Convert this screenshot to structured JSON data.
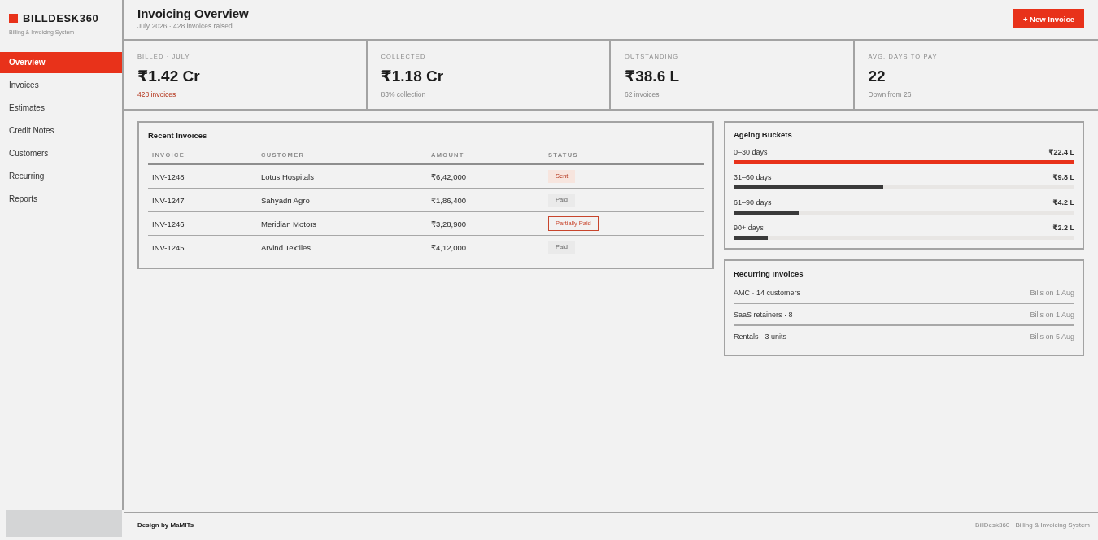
{
  "sidebar": {
    "brand": "BILLDESK360",
    "tagline": "Billing & Invoicing System",
    "items": [
      {
        "label": "Overview",
        "selected": true
      },
      {
        "label": "Invoices",
        "selected": false
      },
      {
        "label": "Estimates",
        "selected": false
      },
      {
        "label": "Credit Notes",
        "selected": false
      },
      {
        "label": "Customers",
        "selected": false
      },
      {
        "label": "Recurring",
        "selected": false
      },
      {
        "label": "Reports",
        "selected": false
      }
    ]
  },
  "header": {
    "title": "Invoicing Overview",
    "subtitle": "July 2026 · 428 invoices raised",
    "button": "+ New Invoice"
  },
  "kpis": [
    {
      "label": "BILLED · JULY",
      "value": "₹1.42 Cr",
      "note": "428 invoices",
      "highlighted": true
    },
    {
      "label": "COLLECTED",
      "value": "₹1.18 Cr",
      "note": "83% collection",
      "highlighted": false
    },
    {
      "label": "OUTSTANDING",
      "value": "₹38.6 L",
      "note": "62 invoices",
      "highlighted": false
    },
    {
      "label": "AVG. DAYS TO PAY",
      "value": "22",
      "note": "Down from 26",
      "highlighted": false
    }
  ],
  "recent_invoices": {
    "title": "Recent Invoices",
    "columns": [
      "INVOICE",
      "CUSTOMER",
      "AMOUNT",
      "STATUS"
    ],
    "rows": [
      {
        "invoice": "INV-1248",
        "customer": "Lotus Hospitals",
        "amount": "₹6,42,000",
        "status": {
          "label": "Sent",
          "kind": "sent"
        }
      },
      {
        "invoice": "INV-1247",
        "customer": "Sahyadri Agro",
        "amount": "₹1,86,400",
        "status": {
          "label": "Paid",
          "kind": "paid"
        }
      },
      {
        "invoice": "INV-1246",
        "customer": "Meridian Motors",
        "amount": "₹3,28,900",
        "status": {
          "label": "Partially Paid",
          "kind": "partial"
        }
      },
      {
        "invoice": "INV-1245",
        "customer": "Arvind Textiles",
        "amount": "₹4,12,000",
        "status": {
          "label": "Paid",
          "kind": "paid"
        }
      }
    ]
  },
  "ageing": {
    "title": "Ageing Buckets",
    "buckets": [
      {
        "label": "0–30 days",
        "amount": "₹22.4 L",
        "level": 1.0,
        "color": "#e8321a"
      },
      {
        "label": "31–60 days",
        "amount": "₹9.8 L",
        "level": 0.44,
        "color": "#3a3a3a"
      },
      {
        "label": "61–90 days",
        "amount": "₹4.2 L",
        "level": 0.19,
        "color": "#3a3a3a"
      },
      {
        "label": "90+ days",
        "amount": "₹2.2 L",
        "level": 0.1,
        "color": "#3a3a3a"
      }
    ]
  },
  "recurring": {
    "title": "Recurring Invoices",
    "items": [
      {
        "name": "AMC · 14 customers",
        "schedule": "Bills on 1 Aug"
      },
      {
        "name": "SaaS retainers · 8",
        "schedule": "Bills on 1 Aug"
      },
      {
        "name": "Rentals · 3 units",
        "schedule": "Bills on 5 Aug"
      }
    ]
  },
  "footer": {
    "credit": "Design by MaMITs",
    "caption": "BillDesk360 · Billing & Invoicing System"
  }
}
